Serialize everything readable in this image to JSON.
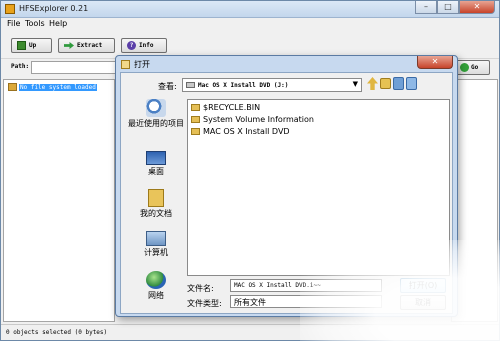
{
  "app": {
    "title": "HFSExplorer 0.21",
    "menu": [
      "File",
      "Tools",
      "Help"
    ],
    "toolbar": {
      "up_label": "Up",
      "extract_label": "Extract",
      "info_label": "Info"
    },
    "path_label": "Path:",
    "path_value": "",
    "go_label": "Go",
    "tree": {
      "root_label": "No file system loaded"
    },
    "status": "0 objects selected (0 bytes)"
  },
  "dialog": {
    "title": "打开",
    "lookin_label": "查看:",
    "lookin_value": "Mac OS X Install DVD (J:)",
    "places": [
      {
        "label": "最近使用的项目",
        "icon": "recent-icon"
      },
      {
        "label": "桌面",
        "icon": "desktop-icon"
      },
      {
        "label": "我的文档",
        "icon": "documents-icon"
      },
      {
        "label": "计算机",
        "icon": "computer-icon"
      },
      {
        "label": "网络",
        "icon": "network-icon"
      }
    ],
    "files": [
      {
        "name": "$RECYCLE.BIN"
      },
      {
        "name": "System Volume Information"
      },
      {
        "name": "MAC OS X Install DVD"
      }
    ],
    "filename_label": "文件名:",
    "filename_value": "MAC OS X Install DVD.i~~",
    "filetype_label": "文件类型:",
    "filetype_value": "所有文件",
    "open_label": "打开(O)",
    "cancel_label": "取消"
  }
}
